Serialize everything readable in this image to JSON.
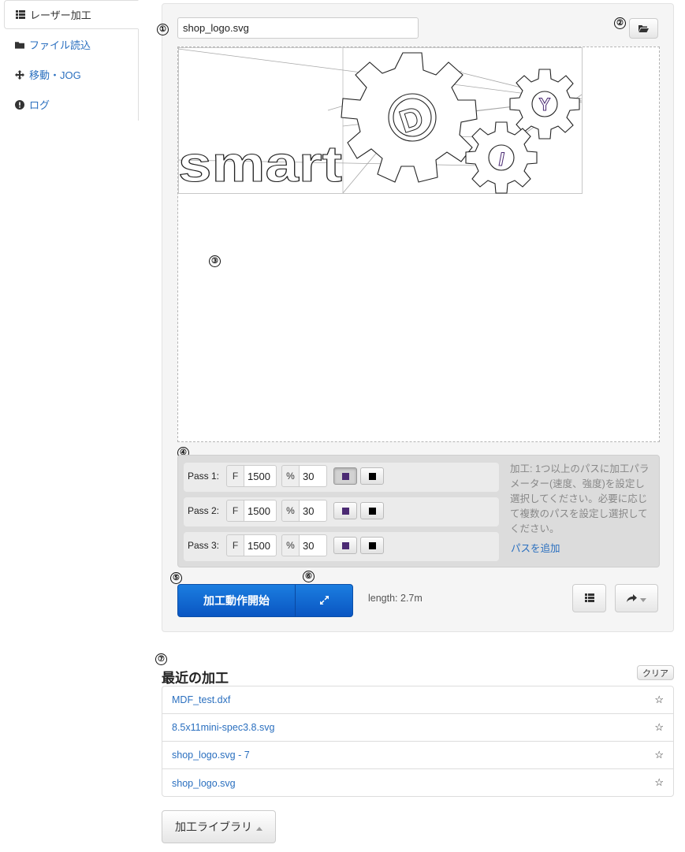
{
  "sidebar": {
    "items": [
      {
        "label": "レーザー加工",
        "icon": "list-icon",
        "active": true
      },
      {
        "label": "ファイル読込",
        "icon": "folder-icon",
        "active": false
      },
      {
        "label": "移動・JOG",
        "icon": "move-arrows-icon",
        "active": false
      },
      {
        "label": "ログ",
        "icon": "exclamation-circle-icon",
        "active": false
      }
    ]
  },
  "annotations": [
    "①",
    "②",
    "③",
    "④",
    "⑤",
    "⑥",
    "⑦"
  ],
  "job": {
    "file_name": "shop_logo.svg",
    "open_icon": "folder-open-icon",
    "preview_text": "smart",
    "gear_letters": [
      "D",
      "Y",
      "I"
    ]
  },
  "passes": [
    {
      "label": "Pass 1:",
      "f_addon": "F",
      "feedrate": "1500",
      "pct_addon": "%",
      "intensity": "30",
      "color_selected": "purple"
    },
    {
      "label": "Pass 2:",
      "f_addon": "F",
      "feedrate": "1500",
      "pct_addon": "%",
      "intensity": "30",
      "color_selected": "none"
    },
    {
      "label": "Pass 3:",
      "f_addon": "F",
      "feedrate": "1500",
      "pct_addon": "%",
      "intensity": "30",
      "color_selected": "none"
    }
  ],
  "swatch_colors": {
    "purple": "#4b2a73",
    "black": "#000000"
  },
  "help_text": "加工: 1つ以上のパスに加工パラメーター(速度、強度)を設定し選択してください。必要に応じて複数のパスを設定し選択してください。",
  "add_pass": "パスを追加",
  "actions": {
    "start_label": "加工動作開始",
    "expand_icon": "expand-arrows-icon",
    "length": "length: 2.7m",
    "list_icon": "list-icon",
    "share_icon": "share-arrow-icon"
  },
  "recent": {
    "title": "最近の加工",
    "clear": "クリア",
    "items": [
      {
        "name": "MDF_test.dxf",
        "star": "☆"
      },
      {
        "name": "8.5x11mini-spec3.8.svg",
        "star": "☆"
      },
      {
        "name": "shop_logo.svg - 7",
        "star": "☆"
      },
      {
        "name": "shop_logo.svg",
        "star": "☆"
      }
    ]
  },
  "library": {
    "label": "加工ライブラリ"
  },
  "colors": {
    "primary": "#0a64d0",
    "link": "#2a6fbf"
  }
}
